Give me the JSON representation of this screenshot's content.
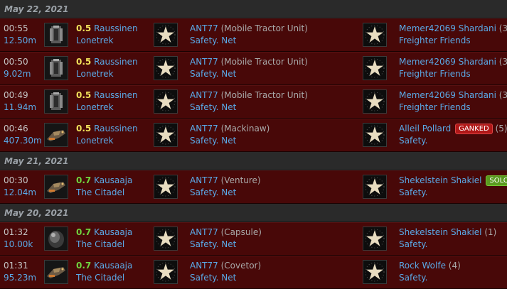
{
  "colors": {
    "row_bg": "#480808",
    "header_bg": "#2a2a2a",
    "link": "#5aa9e6",
    "sec_05": "#f0e05a",
    "sec_07": "#6fd43f",
    "ganked_badge": "#b01818",
    "solo_badge": "#5a9a20"
  },
  "days": [
    {
      "date": "May 22, 2021",
      "kills": [
        {
          "time": "00:55",
          "value": "12.50m",
          "ship_icon": "mobile-tractor-unit-icon",
          "sec": "0.5",
          "system": "Raussinen",
          "region": "Lonetrek",
          "victim": "ANT77",
          "victim_ship": "(Mobile Tractor Unit)",
          "victim_corp": "Safety. Net",
          "attacker": "Memer42069 Shardani",
          "attacker_count": "(3",
          "badge": "",
          "attacker_corp": "Freighter Friends"
        },
        {
          "time": "00:50",
          "value": "9.02m",
          "ship_icon": "mobile-tractor-unit-icon",
          "sec": "0.5",
          "system": "Raussinen",
          "region": "Lonetrek",
          "victim": "ANT77",
          "victim_ship": "(Mobile Tractor Unit)",
          "victim_corp": "Safety. Net",
          "attacker": "Memer42069 Shardani",
          "attacker_count": "(3",
          "badge": "",
          "attacker_corp": "Freighter Friends"
        },
        {
          "time": "00:49",
          "value": "11.94m",
          "ship_icon": "mobile-tractor-unit-icon",
          "sec": "0.5",
          "system": "Raussinen",
          "region": "Lonetrek",
          "victim": "ANT77",
          "victim_ship": "(Mobile Tractor Unit)",
          "victim_corp": "Safety. Net",
          "attacker": "Memer42069 Shardani",
          "attacker_count": "(3",
          "badge": "",
          "attacker_corp": "Freighter Friends"
        },
        {
          "time": "00:46",
          "value": "407.30m",
          "ship_icon": "mackinaw-ship-icon",
          "sec": "0.5",
          "system": "Raussinen",
          "region": "Lonetrek",
          "victim": "ANT77",
          "victim_ship": "(Mackinaw)",
          "victim_corp": "Safety. Net",
          "attacker": "Alleil Pollard",
          "attacker_count": "(5)",
          "badge": "GANKED",
          "attacker_corp": "Safety."
        }
      ]
    },
    {
      "date": "May 21, 2021",
      "kills": [
        {
          "time": "00:30",
          "value": "12.04m",
          "ship_icon": "venture-ship-icon",
          "sec": "0.7",
          "system": "Kausaaja",
          "region": "The Citadel",
          "victim": "ANT77",
          "victim_ship": "(Venture)",
          "victim_corp": "Safety. Net",
          "attacker": "Shekelstein Shakiel",
          "attacker_count": "",
          "badge": "SOLO",
          "attacker_corp": "Safety."
        }
      ]
    },
    {
      "date": "May 20, 2021",
      "kills": [
        {
          "time": "01:32",
          "value": "10.00k",
          "ship_icon": "capsule-icon",
          "sec": "0.7",
          "system": "Kausaaja",
          "region": "The Citadel",
          "victim": "ANT77",
          "victim_ship": "(Capsule)",
          "victim_corp": "Safety. Net",
          "attacker": "Shekelstein Shakiel",
          "attacker_count": "(1)",
          "badge": "",
          "attacker_corp": "Safety."
        },
        {
          "time": "01:31",
          "value": "95.23m",
          "ship_icon": "covetor-ship-icon",
          "sec": "0.7",
          "system": "Kausaaja",
          "region": "The Citadel",
          "victim": "ANT77",
          "victim_ship": "(Covetor)",
          "victim_corp": "Safety. Net",
          "attacker": "Rock Wolfe",
          "attacker_count": "(4)",
          "badge": "",
          "attacker_corp": "Safety."
        }
      ]
    }
  ]
}
